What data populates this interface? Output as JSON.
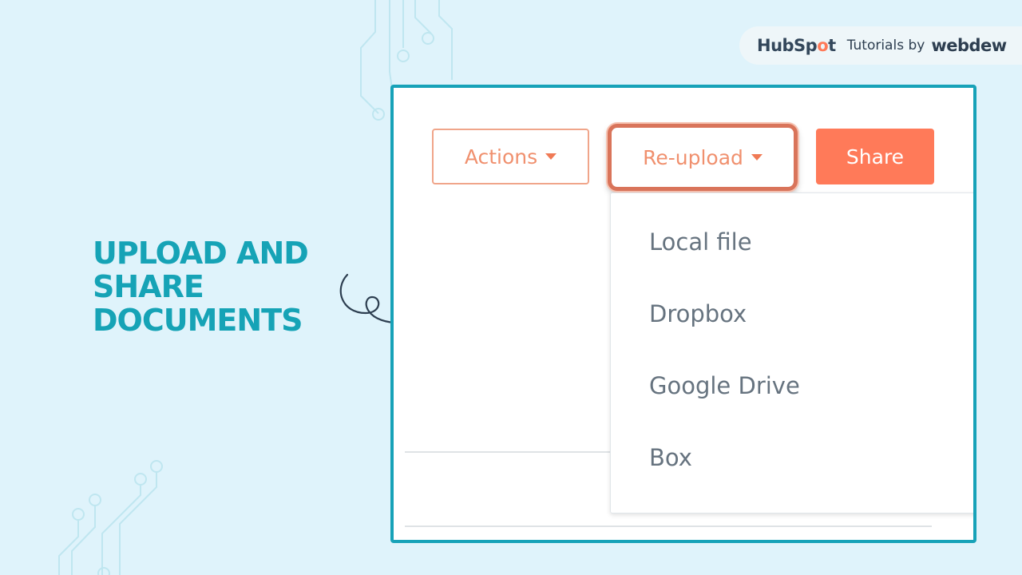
{
  "brand": {
    "hubspot_prefix": "HubSp",
    "hubspot_o": "o",
    "hubspot_suffix": "t",
    "tutorials_by": "Tutorials by",
    "webdew": "webdew"
  },
  "headline": {
    "lines": [
      "UPLOAD AND",
      "SHARE",
      "DOCUMENTS"
    ]
  },
  "toolbar": {
    "actions_label": "Actions",
    "reupload_label": "Re-upload",
    "share_label": "Share"
  },
  "reupload_menu": {
    "items": [
      "Local file",
      "Dropbox",
      "Google Drive",
      "Box"
    ]
  },
  "colors": {
    "accent": "#ff7a59",
    "headline": "#16a3b6",
    "frame_border": "#17a2b8",
    "background": "#dff3fb"
  },
  "icons": [
    "caret-down-icon",
    "curved-arrow-icon",
    "circuit-decoration-icon",
    "sprocket-logo-icon"
  ]
}
